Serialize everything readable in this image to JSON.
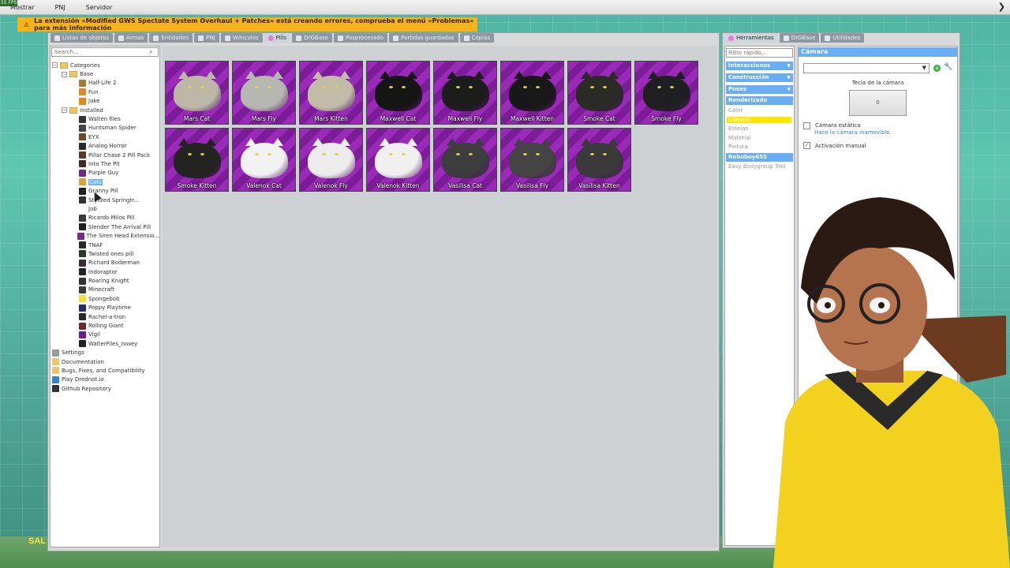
{
  "hud": {
    "fps": "55 FPS"
  },
  "topbar": {
    "items": [
      "Mostrar",
      "PNJ",
      "Servidor"
    ]
  },
  "warning": {
    "text": "La extensión «Modified GWS Spectate System Overhaul + Patches» está creando errores, comprueba el menú «Problemas» para más información"
  },
  "spawnmenu": {
    "tabs": [
      "Listas de objetos",
      "Armas",
      "Entidades",
      "PNJ",
      "Vehículos",
      "Pills",
      "DrGBase",
      "Posprocesado",
      "Partidas guardadas",
      "Copias"
    ],
    "active_tab": "Pills",
    "search_placeholder": "Search...",
    "tree": [
      {
        "label": "Categories",
        "level": 0,
        "type": "folder",
        "expander": "−"
      },
      {
        "label": "Base",
        "level": 1,
        "type": "folder",
        "expander": "−"
      },
      {
        "label": "Half-Life 2",
        "level": 2,
        "icon": "#a87a3a"
      },
      {
        "label": "Fun",
        "level": 2,
        "icon": "#d98a2a"
      },
      {
        "label": "Jake",
        "level": 2,
        "icon": "#e08a1a"
      },
      {
        "label": "Installed",
        "level": 1,
        "type": "folder",
        "expander": "−"
      },
      {
        "label": "Walten files",
        "level": 2,
        "icon": "#333333"
      },
      {
        "label": "Huntsman Spider",
        "level": 2,
        "icon": "#444444"
      },
      {
        "label": "EYX",
        "level": 2,
        "icon": "#6d4a2a"
      },
      {
        "label": "Analog Horror",
        "level": 2,
        "icon": "#2a2a2a"
      },
      {
        "label": "Pillar Chase 2 Pill Pack",
        "level": 2,
        "icon": "#5a3a2a"
      },
      {
        "label": "Into The Pit",
        "level": 2,
        "icon": "#3a2a2a"
      },
      {
        "label": "Purple Guy",
        "level": 2,
        "icon": "#6b2a8c"
      },
      {
        "label": "Cats",
        "level": 2,
        "icon": "#d9a53a",
        "selected": true
      },
      {
        "label": "Granny Pill",
        "level": 2,
        "icon": "#222222"
      },
      {
        "label": "Stylized Springtr...",
        "level": 2,
        "icon": "#333333"
      },
      {
        "label": "Job",
        "level": 2,
        "icon": "#ffffff"
      },
      {
        "label": "Ricardo Milos Pill",
        "level": 2,
        "icon": "#3a3a3a"
      },
      {
        "label": "Slender The Arrival Pill",
        "level": 2,
        "icon": "#222222"
      },
      {
        "label": "The Siren Head Extensio...",
        "level": 2,
        "icon": "#7a2a8a"
      },
      {
        "label": "TNAF",
        "level": 2,
        "icon": "#2a2a2a"
      },
      {
        "label": "Twisted ones pill",
        "level": 2,
        "icon": "#2a3a2a"
      },
      {
        "label": "Richard Boderman",
        "level": 2,
        "icon": "#3a2a3a"
      },
      {
        "label": "Indoraptor",
        "level": 2,
        "icon": "#222222"
      },
      {
        "label": "Roaring Knight",
        "level": 2,
        "icon": "#333333"
      },
      {
        "label": "Minecraft",
        "level": 2,
        "icon": "#3a3a3a"
      },
      {
        "label": "Spongebob",
        "level": 2,
        "icon": "#f0e030"
      },
      {
        "label": "Poppy Playtime",
        "level": 2,
        "icon": "#2a2a6a"
      },
      {
        "label": "Rachel-a-tron",
        "level": 2,
        "icon": "#2a2a2a"
      },
      {
        "label": "Rolling Giant",
        "level": 2,
        "icon": "#6a2a2a"
      },
      {
        "label": "Vigil",
        "level": 2,
        "icon": "#6a1a8a"
      },
      {
        "label": "WalterFiles_nosey",
        "level": 2,
        "icon": "#222222"
      },
      {
        "label": "Settings",
        "level": 0,
        "icon": "#9a9a9a"
      },
      {
        "label": "Documentation",
        "level": 0,
        "icon": "#e8c86a"
      },
      {
        "label": "Bugs, Fixes, and Compatibility",
        "level": 0,
        "icon": "#e8c86a"
      },
      {
        "label": "Play Drednot.io",
        "level": 0,
        "icon": "#3a7fd0"
      },
      {
        "label": "Github Repository",
        "level": 0,
        "icon": "#333333"
      }
    ],
    "pills": [
      {
        "label": "Mars Cat",
        "fur": "#bdb7a8"
      },
      {
        "label": "Mars Fly",
        "fur": "#b7b7b2"
      },
      {
        "label": "Mars Kitten",
        "fur": "#c2bba8"
      },
      {
        "label": "Maxwell Cat",
        "fur": "#151515"
      },
      {
        "label": "Maxwell Fly",
        "fur": "#1c1c1c"
      },
      {
        "label": "Maxwell Kitten",
        "fur": "#181818"
      },
      {
        "label": "Smoke Cat",
        "fur": "#2b2b26"
      },
      {
        "label": "Smoke Fly",
        "fur": "#1f1f22"
      },
      {
        "label": "Smoke Kitten",
        "fur": "#232320"
      },
      {
        "label": "Valenok Cat",
        "fur": "#f2f2f2"
      },
      {
        "label": "Valenok Fly",
        "fur": "#ececec"
      },
      {
        "label": "Valenok Kitten",
        "fur": "#f0f0f0"
      },
      {
        "label": "Vasilisa Cat",
        "fur": "#3d3d3d"
      },
      {
        "label": "Vasilisa Fly",
        "fur": "#444444"
      },
      {
        "label": "Vasilisa Kitten",
        "fur": "#3a3a3a"
      }
    ]
  },
  "tools": {
    "tabs": [
      "Herramientas",
      "DrGBase",
      "Utilidades"
    ],
    "filter_placeholder": "Filtro rápido...",
    "headers": [
      "Interacciones",
      "Construcción",
      "Poses",
      "Renderizado"
    ],
    "render_items": [
      "Color",
      "Cámara",
      "Estelas",
      "Material",
      "Pintura"
    ],
    "highlighted_item": "Cámara",
    "user_header": "Roboboy655",
    "user_items": [
      "Easy Bodygroup Tool"
    ],
    "panel": {
      "title": "Cámara",
      "key_label": "Tecla de la cámara",
      "key_value": "0",
      "static_label": "Cámara estática",
      "static_help": "Hace la cámara inamovible.",
      "manual_label": "Activación manual"
    }
  },
  "hud_text": {
    "sal": "SAL"
  }
}
